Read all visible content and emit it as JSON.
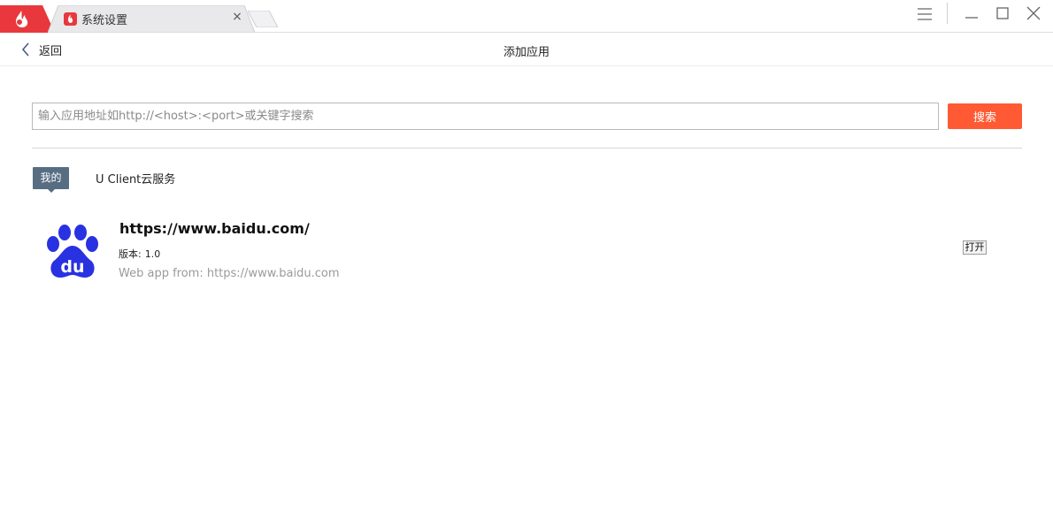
{
  "tab": {
    "title": "系统设置",
    "close_glyph": "×"
  },
  "titlebar": {
    "icons": [
      "app-logo-icon",
      "menu-icon",
      "minimize-icon",
      "maximize-icon",
      "close-icon"
    ]
  },
  "nav": {
    "back_label": "返回",
    "page_title": "添加应用"
  },
  "search": {
    "placeholder": "输入应用地址如http://<host>:<port>或关键字搜索",
    "value": "",
    "button_label": "搜索"
  },
  "categories": [
    {
      "label": "我的",
      "active": true
    },
    {
      "label": "U Client云服务",
      "active": false
    }
  ],
  "apps": [
    {
      "name": "https://www.baidu.com/",
      "version_label": "版本:",
      "version": "1.0",
      "source": "Web app  from: https://www.baidu.com",
      "icon": "baidu-paw-icon",
      "action_label": "打开"
    }
  ],
  "colors": {
    "accent": "#ff5a33",
    "brand_red": "#e8383d",
    "tag_bg": "#566d82",
    "baidu_blue": "#2932e1"
  }
}
